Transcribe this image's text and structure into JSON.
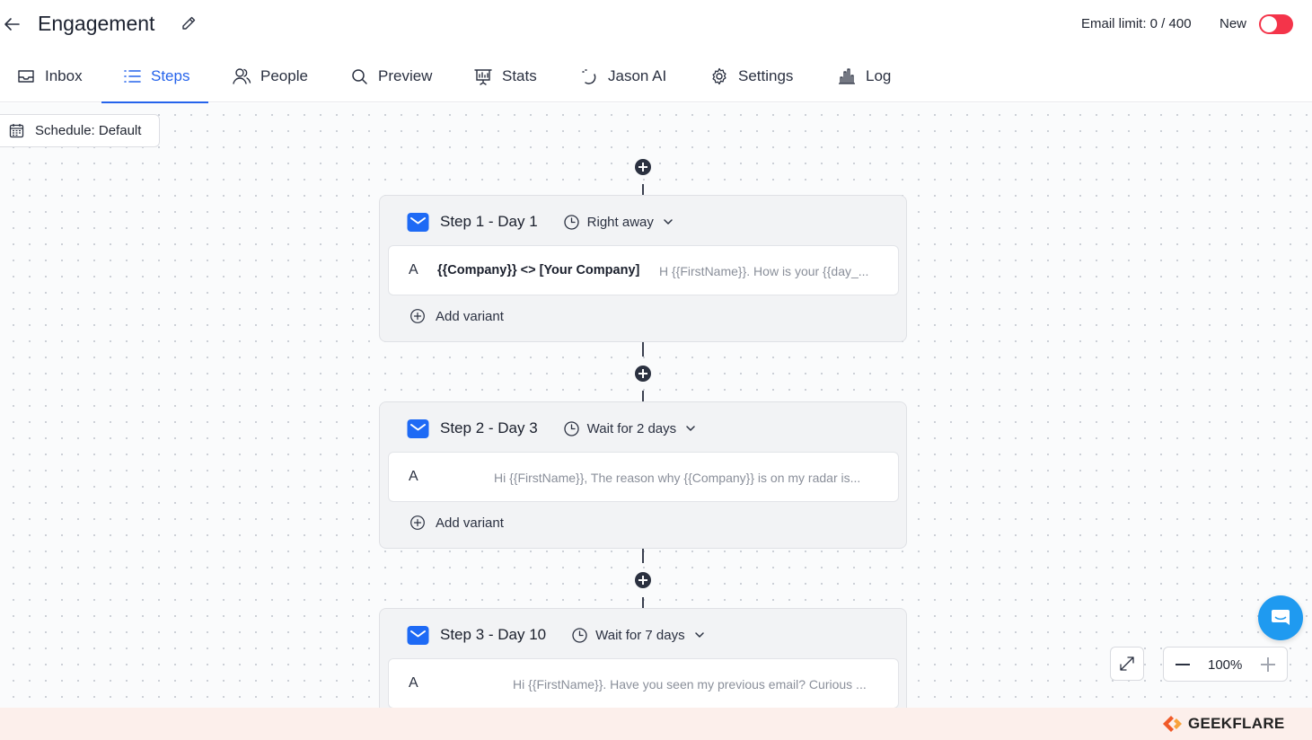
{
  "header": {
    "title": "Engagement",
    "email_limit": "Email limit:  0 / 400",
    "new_label": "New"
  },
  "tabs": [
    {
      "label": "Inbox",
      "icon": "inbox-icon"
    },
    {
      "label": "Steps",
      "icon": "list-icon",
      "active": true
    },
    {
      "label": "People",
      "icon": "people-icon"
    },
    {
      "label": "Preview",
      "icon": "search-icon"
    },
    {
      "label": "Stats",
      "icon": "presentation-chart-icon"
    },
    {
      "label": "Jason AI",
      "icon": "spinner-icon"
    },
    {
      "label": "Settings",
      "icon": "gear-icon"
    },
    {
      "label": "Log",
      "icon": "bar-chart-icon"
    }
  ],
  "schedule": {
    "label": "Schedule: Default"
  },
  "steps": [
    {
      "title": "Step 1 - Day 1",
      "wait": "Right away",
      "variant_letter": "A",
      "subject": "{{Company}} <> [Your Company]",
      "preview": "H {{FirstName}}. How is your {{day_...",
      "add_variant": "Add variant"
    },
    {
      "title": "Step 2 - Day 3",
      "wait": "Wait for 2 days",
      "variant_letter": "A",
      "subject": "",
      "preview": "Hi {{FirstName}}, The reason why {{Company}} is on my radar is...",
      "add_variant": "Add variant"
    },
    {
      "title": "Step 3 - Day 10",
      "wait": "Wait for 7 days",
      "variant_letter": "A",
      "subject": "",
      "preview": "Hi {{FirstName}}. Have you seen my previous email? Curious ..."
    }
  ],
  "zoom": {
    "value": "100%"
  },
  "footer": {
    "brand": "GEEKFLARE"
  },
  "colors": {
    "accent": "#2563eb",
    "toggle": "#f4344a",
    "mail_icon": "#1e6af5",
    "chat": "#1f9af0",
    "brand": "#f05a28"
  }
}
